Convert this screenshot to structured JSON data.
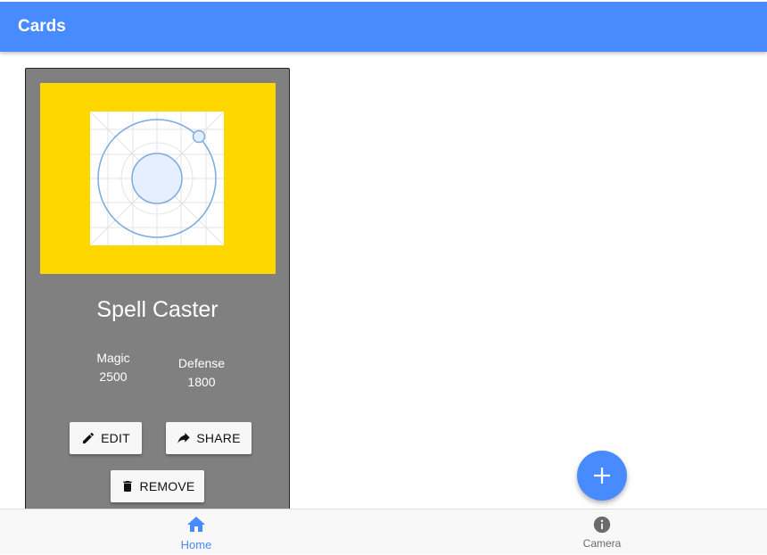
{
  "appbar": {
    "title": "Cards"
  },
  "card": {
    "title": "Spell Caster",
    "stats": [
      {
        "label": "Magic",
        "value": "2500"
      },
      {
        "label": "Defense",
        "value": "1800"
      }
    ],
    "buttons": {
      "edit": "EDIT",
      "share": "SHARE",
      "remove": "REMOVE"
    },
    "colors": {
      "card_bg": "#808080",
      "image_bg": "#ffd700"
    }
  },
  "fab": {
    "icon": "add-icon"
  },
  "tabs": [
    {
      "label": "Home",
      "icon": "home-icon",
      "selected": true
    },
    {
      "label": "Camera",
      "icon": "info-icon",
      "selected": false
    }
  ],
  "colors": {
    "primary": "#488aff",
    "inactive": "#6b6b6b"
  }
}
